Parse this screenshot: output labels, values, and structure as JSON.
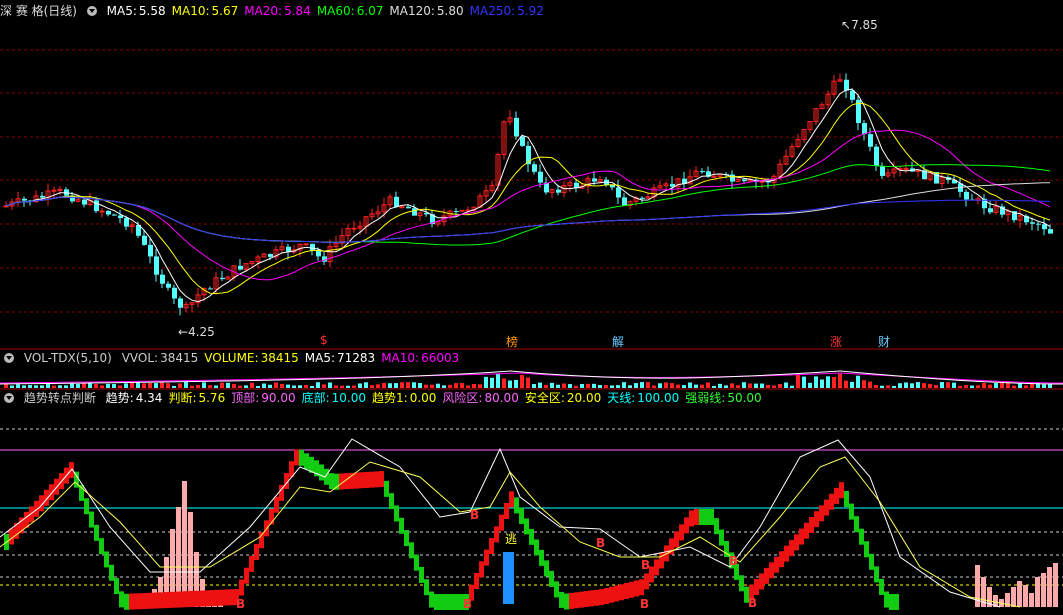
{
  "main_legend": {
    "stock_name": "深 赛 格(日线)",
    "items": [
      {
        "label": "MA5:",
        "value": "5.58",
        "color": "#ffffff"
      },
      {
        "label": "MA10:",
        "value": "5.67",
        "color": "#ffff00"
      },
      {
        "label": "MA20:",
        "value": "5.84",
        "color": "#ff00ff"
      },
      {
        "label": "MA60:",
        "value": "6.07",
        "color": "#00ff00"
      },
      {
        "label": "MA120:",
        "value": "5.80",
        "color": "#dddddd"
      },
      {
        "label": "MA250:",
        "value": "5.92",
        "color": "#3333ff"
      }
    ]
  },
  "price_annotations": {
    "high": "7.85",
    "low": "4.25"
  },
  "event_markers": [
    {
      "label": "$",
      "color": "#ff3333"
    },
    {
      "label": "榜",
      "color": "#ff9900"
    },
    {
      "label": "解",
      "color": "#66ccff"
    },
    {
      "label": "涨",
      "color": "#ff3333"
    },
    {
      "label": "财",
      "color": "#66ccff"
    }
  ],
  "vol_legend": {
    "name": "VOL-TDX(5,10)",
    "items": [
      {
        "label": "VVOL:",
        "value": "38415",
        "color": "#cccccc"
      },
      {
        "label": "VOLUME:",
        "value": "38415",
        "color": "#ffff00"
      },
      {
        "label": "MA5:",
        "value": "71283",
        "color": "#ffffff"
      },
      {
        "label": "MA10:",
        "value": "66003",
        "color": "#ff00ff"
      }
    ]
  },
  "ind_legend": {
    "name": "趋势转点判断",
    "items": [
      {
        "label": "趋势:",
        "value": "4.34",
        "color": "#ffffff"
      },
      {
        "label": "判断:",
        "value": "5.76",
        "color": "#ffff00"
      },
      {
        "label": "顶部:",
        "value": "90.00",
        "color": "#ff66ff"
      },
      {
        "label": "底部:",
        "value": "10.00",
        "color": "#00ffff"
      },
      {
        "label": "趋势1:",
        "value": "0.00",
        "color": "#ffff00"
      },
      {
        "label": "风险区:",
        "value": "80.00",
        "color": "#ff66ff"
      },
      {
        "label": "安全区:",
        "value": "20.00",
        "color": "#ffff00"
      },
      {
        "label": "天线:",
        "value": "100.00",
        "color": "#00ffff"
      },
      {
        "label": "强弱线:",
        "value": "50.00",
        "color": "#33ff33"
      }
    ]
  },
  "indicator_labels": {
    "buy": "B",
    "escape": "逃"
  },
  "colors": {
    "up": "#ff2222",
    "down": "#54ffff",
    "bg": "#000000",
    "grid": "#8b0000"
  }
}
